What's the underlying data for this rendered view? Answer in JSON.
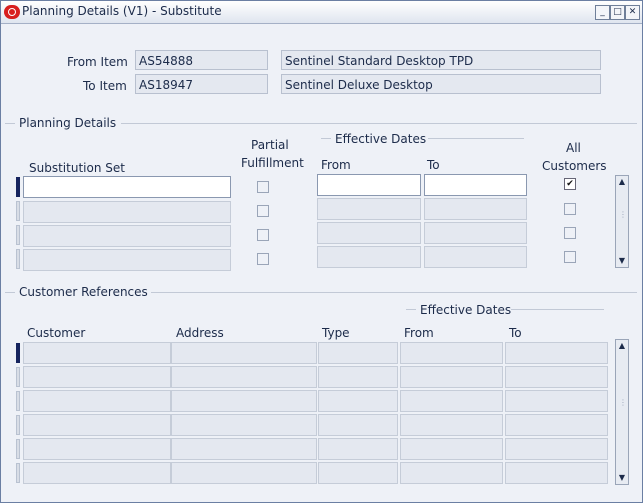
{
  "window": {
    "title": "Planning Details (V1) - Substitute"
  },
  "header": {
    "from_item_label": "From Item",
    "from_item": "AS54888",
    "from_desc": "Sentinel Standard Desktop TPD",
    "to_item_label": "To Item",
    "to_item": "AS18947",
    "to_desc": "Sentinel Deluxe Desktop"
  },
  "planning": {
    "section_title": "Planning Details",
    "col_substitution_set": "Substitution Set",
    "col_partial_line1": "Partial",
    "col_partial_line2": "Fulfillment",
    "effective_dates": "Effective Dates",
    "col_from": "From",
    "col_to": "To",
    "col_all_line1": "All",
    "col_all_line2": "Customers",
    "rows": [
      {
        "set": "",
        "partial": false,
        "from": "",
        "to": "",
        "all": true
      },
      {
        "set": "",
        "partial": false,
        "from": "",
        "to": "",
        "all": false
      },
      {
        "set": "",
        "partial": false,
        "from": "",
        "to": "",
        "all": false
      },
      {
        "set": "",
        "partial": false,
        "from": "",
        "to": "",
        "all": false
      }
    ]
  },
  "customers": {
    "section_title": "Customer References",
    "effective_dates": "Effective Dates",
    "col_customer": "Customer",
    "col_address": "Address",
    "col_type": "Type",
    "col_from": "From",
    "col_to": "To",
    "rows": [
      {},
      {},
      {},
      {},
      {},
      {}
    ]
  }
}
